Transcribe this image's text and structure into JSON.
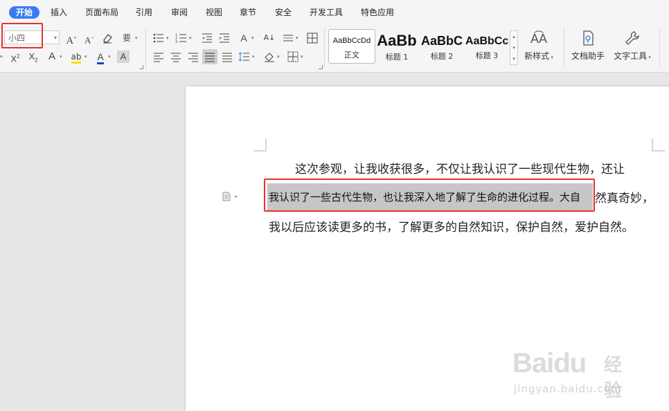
{
  "menu": {
    "tabs": [
      "开始",
      "插入",
      "页面布局",
      "引用",
      "审阅",
      "视图",
      "章节",
      "安全",
      "开发工具",
      "特色应用"
    ]
  },
  "ribbon": {
    "font_size_value": "小四",
    "styles": [
      {
        "sample": "AaBbCcDd",
        "name": "正文"
      },
      {
        "sample": "AaBb",
        "name": "标题 1"
      },
      {
        "sample": "AaBbC",
        "name": "标题 2"
      },
      {
        "sample": "AaBbCc",
        "name": "标题 3"
      }
    ],
    "new_style_label": "新样式",
    "doc_assistant_label": "文档助手",
    "text_tools_label": "文字工具"
  },
  "document": {
    "line1": "这次参观，让我收获很多，不仅让我认识了一些现代生物，还让",
    "line2_selected": "我认识了一些古代生物，也让我深入地了解了生命的进化过程。大自",
    "line2_rest": "然真奇妙，",
    "line3": "我以后应该读更多的书，了解更多的自然知识，保护自然，爱护自然。"
  },
  "watermark": {
    "brand": "Baidu",
    "brand_cn": "经验",
    "url": "jingyan.baidu.com"
  },
  "colors": {
    "active_tab": "#3a7cf0",
    "annotation_red": "#e8302a",
    "selection": "#c6c6c6"
  }
}
